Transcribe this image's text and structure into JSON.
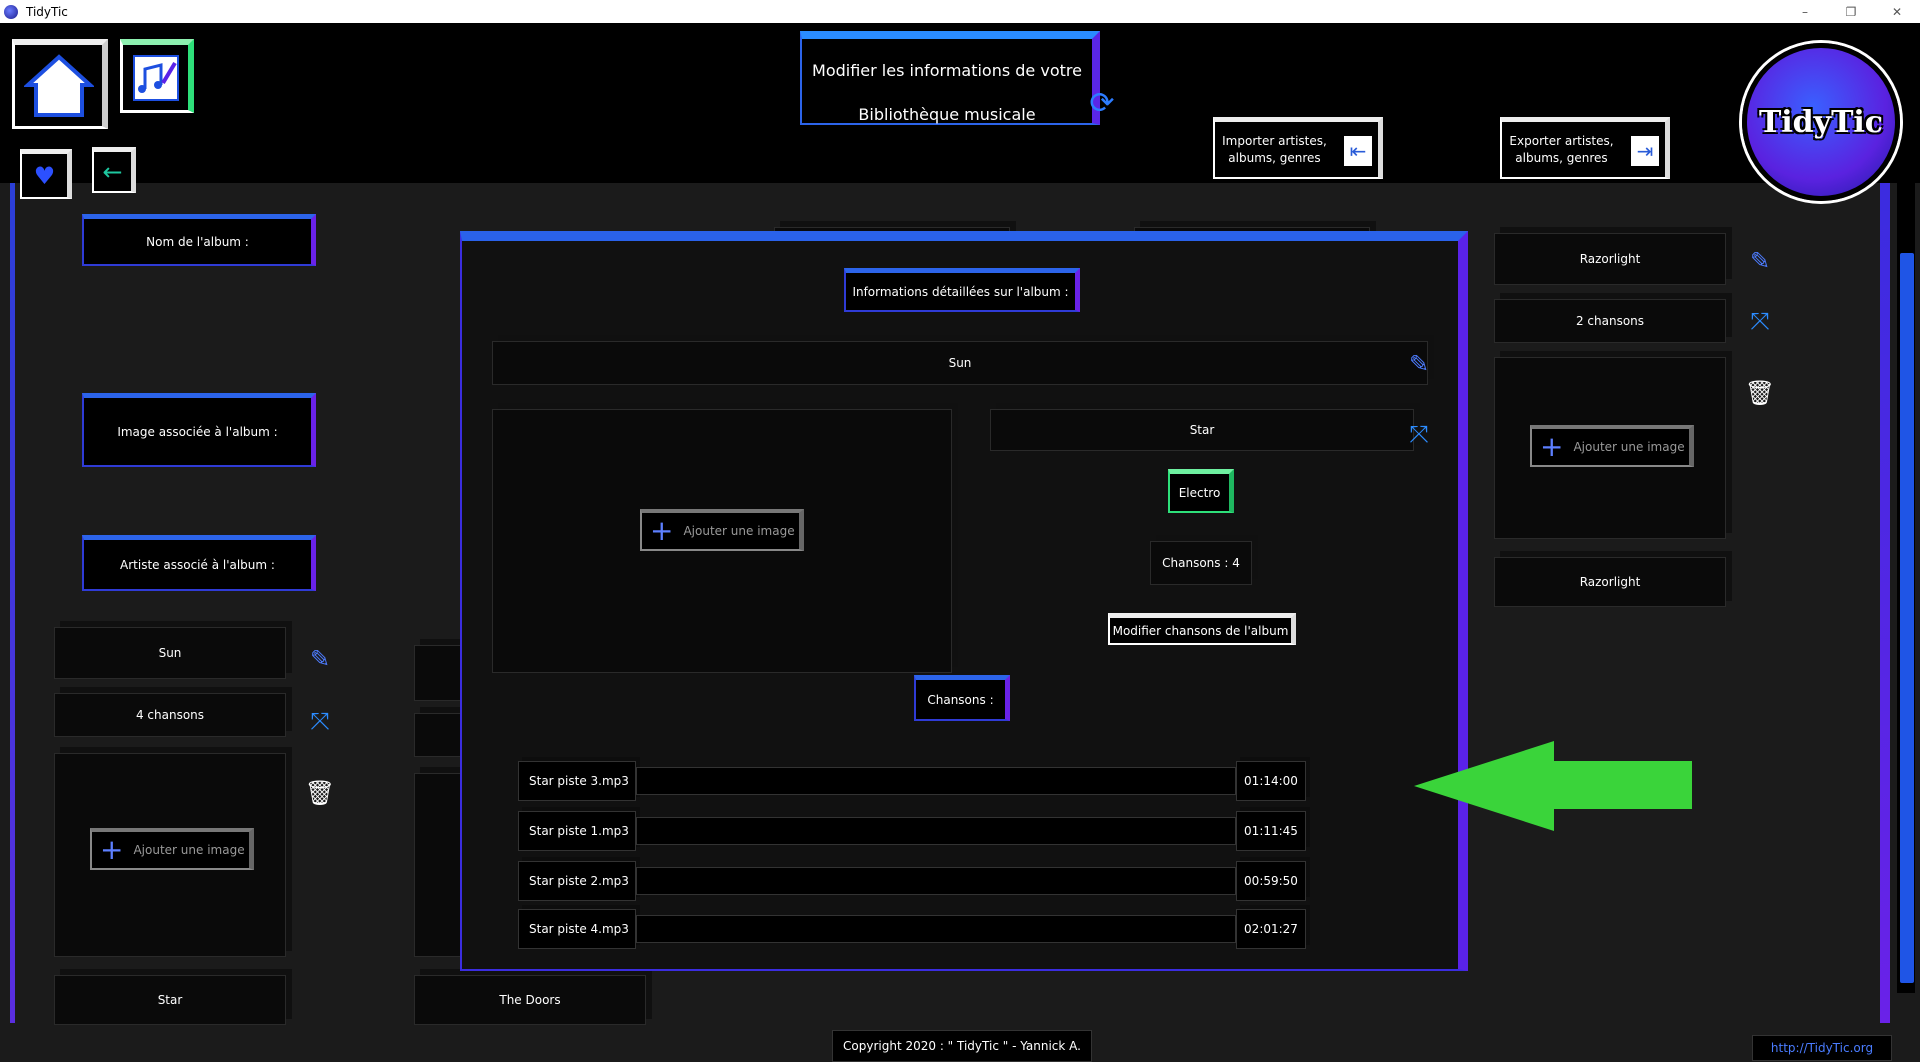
{
  "window": {
    "title": "TidyTic",
    "minimize": "–",
    "restore": "❐",
    "close": "✕"
  },
  "header": {
    "title_line1": "Modifier les informations de votre",
    "title_line2": "Bibliothèque musicale",
    "import_label_1": "Importer artistes,",
    "import_label_2": "albums, genres",
    "export_label_1": "Exporter artistes,",
    "export_label_2": "albums, genres",
    "logo_text": "TidyTic"
  },
  "left_panel": {
    "album_name_label": "Nom de l'album :",
    "album_image_label": "Image associée à l'album :",
    "album_artist_label": "Artiste associé à l'album :"
  },
  "cards": {
    "left": {
      "name": "Sun",
      "count": "4 chansons",
      "add_image": "Ajouter une image",
      "artist": "Star"
    },
    "middle": {
      "artist": "The Doors"
    },
    "right": {
      "name": "Razorlight",
      "count": "2 chansons",
      "add_image": "Ajouter une image",
      "artist": "Razorlight"
    }
  },
  "modal": {
    "title": "Informations détaillées sur l'album :",
    "album_name": "Sun",
    "add_image": "Ajouter une image",
    "artist": "Star",
    "genre": "Electro",
    "songs_count": "Chansons  : 4",
    "modify_songs": "Modifier chansons de l'album",
    "songs_header": "Chansons  :",
    "songs": [
      {
        "name": "Star piste 3.mp3",
        "duration": "01:14:00"
      },
      {
        "name": "Star piste 1.mp3",
        "duration": "01:11:45"
      },
      {
        "name": "Star piste 2.mp3",
        "duration": "00:59:50"
      },
      {
        "name": "Star piste 4.mp3",
        "duration": "02:01:27"
      }
    ]
  },
  "footer": {
    "copyright": "Copyright 2020 : \" TidyTic \" - Yannick A.",
    "site": "http://TidyTic.org"
  },
  "colors": {
    "accent_blue": "#2c64ea",
    "accent_purple": "#5a22e8",
    "genre_green": "#2ee07a",
    "arrow_green": "#3ad43a"
  }
}
